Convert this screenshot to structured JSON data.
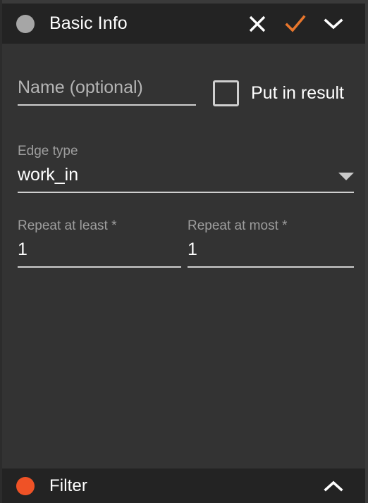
{
  "panel": {
    "header": {
      "status_dot": "grey-dot-icon",
      "title": "Basic Info",
      "actions": [
        {
          "name": "close-icon",
          "label": "✕",
          "color": "#ffffff"
        },
        {
          "name": "confirm-check-icon",
          "label": "✓",
          "color": "#e8762c"
        },
        {
          "name": "chevron-down-icon",
          "label": "⌄",
          "color": "#ffffff"
        }
      ]
    },
    "form": {
      "name_field": {
        "label": "Name (optional)",
        "placeholder": "Name (optional)",
        "value": ""
      },
      "put_in_result": {
        "label": "Put in result",
        "checked": false
      },
      "edge_type": {
        "label": "Edge type",
        "value": "work_in",
        "dropdown_icon": "caret-down-icon"
      },
      "repeat_at_least": {
        "label": "Repeat at least *",
        "value": "1"
      },
      "repeat_at_most": {
        "label": "Repeat at most *",
        "value": "1"
      }
    }
  },
  "filter_section": {
    "status_dot": "orange-dot-icon",
    "title": "Filter",
    "expand_icon": "chevron-up-icon"
  },
  "colors": {
    "header_background": "#232323",
    "body_background": "#333333",
    "accent_orange": "#e8762c",
    "filter_dot": "#ef5226",
    "status_dot_grey": "#a6a6a6",
    "underline": "#cfcfcf",
    "label_grey": "#9e9e9e",
    "text_white": "#ffffff"
  }
}
